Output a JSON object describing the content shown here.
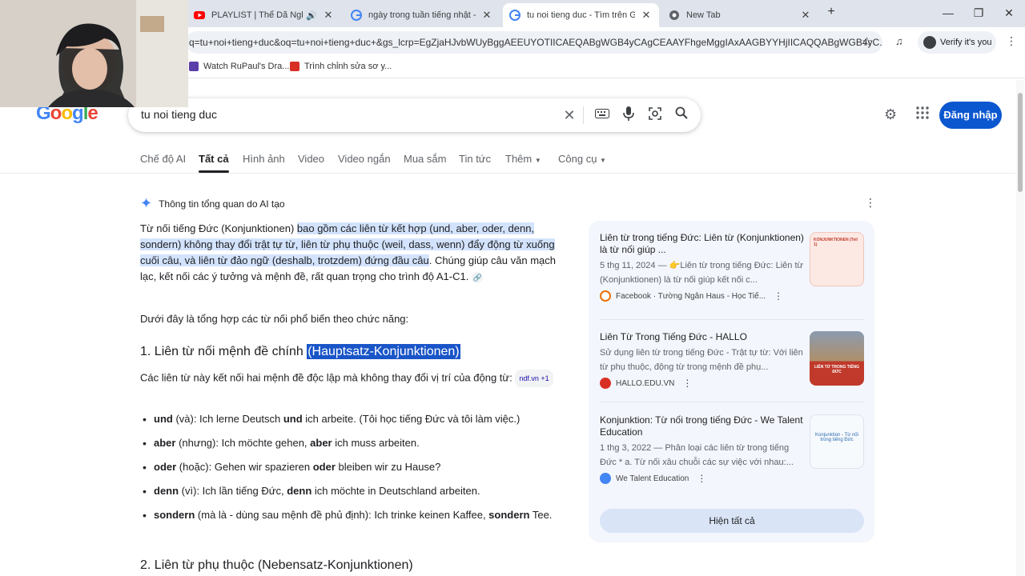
{
  "browser": {
    "tabs": [
      {
        "title": "PLAYLIST | Thể Dã Nghe Nhạc",
        "fav": "yt"
      },
      {
        "title": "ngày trong tuần tiếng nhật - Tìm",
        "fav": "g"
      },
      {
        "title": "tu noi tieng duc - Tìm trên Goo",
        "fav": "g"
      },
      {
        "title": "New Tab",
        "fav": "chrome"
      }
    ],
    "new_tab": "+",
    "url": "q=tu+noi+tieng+duc&oq=tu+noi+tieng+duc+&gs_lcrp=EgZjaHJvbWUyBggAEEUYOTIICAEQABgWGB4yCAgCEAAYFhgeMggIAxAAGBYYHjIICAQQABgWGB4yC...",
    "profile_label": "Verify it's you",
    "bookmarks": [
      "Watch RuPaul's Dra...",
      "Trình chỉnh sửa sơ y..."
    ]
  },
  "google": {
    "logo": "Google",
    "query": "tu noi tieng duc",
    "login": "Đăng nhập",
    "tabs": [
      "Chế độ AI",
      "Tất cả",
      "Hình ảnh",
      "Video",
      "Video ngắn",
      "Mua sắm",
      "Tin tức",
      "Thêm",
      "Công cụ"
    ]
  },
  "ai": {
    "header": "Thông tin tổng quan do AI tạo",
    "intro_plain": "Từ nối tiếng Đức (Konjunktionen) ",
    "intro_highlight": "bao gồm các liên từ kết hợp (und, aber, oder, denn, sondern) không thay đổi trật tự từ, liên từ phụ thuộc (weil, dass, wenn) đẩy động từ xuống cuối câu, và liên từ đảo ngữ (deshalb, trotzdem) đứng đầu câu",
    "intro_rest": ". Chúng giúp câu văn mạch lạc, kết nối các ý tưởng và mệnh đề, rất quan trọng cho trình độ A1-C1.",
    "summary": "Dưới đây là tổng hợp các từ nối phổ biến theo chức năng:",
    "h1_plain": "1. Liên từ nối mệnh đề chính ",
    "h1_selected": "(Hauptsatz-Konjunktionen)",
    "h1_desc": "Các liên từ này kết nối hai mệnh đề độc lập mà không thay đổi vị trí của động từ:",
    "h1_chip": "ndf.vn +1",
    "items": [
      {
        "word": "und",
        "gloss": " (và): Ich lerne Deutsch ",
        "word2": "und",
        "rest": " ich arbeite. (Tôi học tiếng Đức và tôi làm việc.)"
      },
      {
        "word": "aber",
        "gloss": " (nhưng): Ich möchte gehen, ",
        "word2": "aber",
        "rest": " ich muss arbeiten."
      },
      {
        "word": "oder",
        "gloss": " (hoặc): Gehen wir spazieren ",
        "word2": "oder",
        "rest": " bleiben wir zu Hause?"
      },
      {
        "word": "denn",
        "gloss": " (vì): Ich lần tiếng Đức, ",
        "word2": "denn",
        "rest": " ich möchte in Deutschland arbeiten."
      },
      {
        "word": "sondern",
        "gloss": " (mà là - dùng sau mệnh đề phủ định): Ich trinke keinen Kaffee, ",
        "word2": "sondern",
        "rest": " Tee."
      }
    ],
    "h2": "2. Liên từ phụ thuộc (Nebensatz-Konjunktionen)"
  },
  "sources": [
    {
      "title": "Liên từ trong tiếng Đức: Liên từ (Konjunktionen) là từ nối giúp ...",
      "desc": "5 thg 11, 2024 — 👉Liên từ trong tiếng Đức: Liên từ (Konjunktionen) là từ nối giúp kết nối c...",
      "site": "Facebook · Tường Ngân Haus - Học Tiế...",
      "thumb_text": "KONJUNKTIONEN (Teil 1)"
    },
    {
      "title": "Liên Từ Trong Tiếng Đức - HALLO",
      "desc": "Sử dụng liên từ trong tiếng Đức - Trật tự từ: Với liên từ phụ thuộc, động từ trong mệnh đề phụ...",
      "site": "HALLO.EDU.VN",
      "thumb_text": "LIÊN TỪ TRONG TIẾNG ĐỨC"
    },
    {
      "title": "Konjunktion: Từ nối trong tiếng Đức - We Talent Education",
      "desc": "1 thg 3, 2022 — Phân loại các liên từ trong tiếng Đức * a. Từ nối xâu chuỗi các sự việc với nhau:...",
      "site": "We Talent Education",
      "thumb_text": "Konjunktion - Từ nối trong tiếng Đức"
    }
  ],
  "show_all": "Hiện tất cả",
  "colors": {
    "accent": "#0b57d0",
    "highlight": "#d3e3fd",
    "selection": "#1a55c8",
    "panel": "#f3f6fc"
  }
}
